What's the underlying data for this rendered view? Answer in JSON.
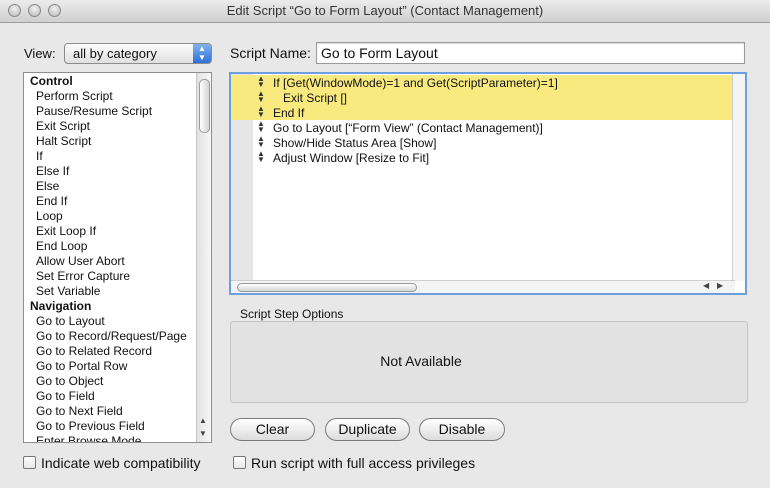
{
  "window": {
    "title": "Edit Script “Go to Form Layout” (Contact Management)"
  },
  "view": {
    "label": "View:",
    "selected": "all by category"
  },
  "script_name": {
    "label": "Script Name:",
    "value": "Go to Form Layout"
  },
  "step_list": {
    "items": [
      {
        "kind": "category",
        "text": "Control"
      },
      {
        "kind": "step",
        "text": "Perform Script"
      },
      {
        "kind": "step",
        "text": "Pause/Resume Script"
      },
      {
        "kind": "step",
        "text": "Exit Script"
      },
      {
        "kind": "step",
        "text": "Halt Script"
      },
      {
        "kind": "step",
        "text": "If"
      },
      {
        "kind": "step",
        "text": "Else If"
      },
      {
        "kind": "step",
        "text": "Else"
      },
      {
        "kind": "step",
        "text": "End If"
      },
      {
        "kind": "step",
        "text": "Loop"
      },
      {
        "kind": "step",
        "text": "Exit Loop If"
      },
      {
        "kind": "step",
        "text": "End Loop"
      },
      {
        "kind": "step",
        "text": "Allow User Abort"
      },
      {
        "kind": "step",
        "text": "Set Error Capture"
      },
      {
        "kind": "step",
        "text": "Set Variable"
      },
      {
        "kind": "category",
        "text": "Navigation"
      },
      {
        "kind": "step",
        "text": "Go to Layout"
      },
      {
        "kind": "step",
        "text": "Go to Record/Request/Page"
      },
      {
        "kind": "step",
        "text": "Go to Related Record"
      },
      {
        "kind": "step",
        "text": "Go to Portal Row"
      },
      {
        "kind": "step",
        "text": "Go to Object"
      },
      {
        "kind": "step",
        "text": "Go to Field"
      },
      {
        "kind": "step",
        "text": "Go to Next Field"
      },
      {
        "kind": "step",
        "text": "Go to Previous Field"
      },
      {
        "kind": "step",
        "text": "Enter Browse Mode"
      }
    ]
  },
  "script_steps": [
    {
      "text": "If [Get(WindowMode)=1 and Get(ScriptParameter)=1]",
      "indent": 0,
      "highlighted": true
    },
    {
      "text": "Exit Script []",
      "indent": 1,
      "highlighted": true
    },
    {
      "text": "End If",
      "indent": 0,
      "highlighted": true
    },
    {
      "text": "Go to Layout [“Form View” (Contact Management)]",
      "indent": 0,
      "highlighted": false
    },
    {
      "text": "Show/Hide Status Area [Show]",
      "indent": 0,
      "highlighted": false
    },
    {
      "text": "Adjust Window [Resize to Fit]",
      "indent": 0,
      "highlighted": false
    }
  ],
  "step_options": {
    "label": "Script Step Options",
    "message": "Not Available"
  },
  "buttons": {
    "clear": "Clear",
    "duplicate": "Duplicate",
    "disable": "Disable"
  },
  "checkboxes": {
    "web_compat": {
      "label": "Indicate web compatibility",
      "checked": false
    },
    "full_access": {
      "label": "Run script with full access privileges",
      "checked": false
    }
  },
  "icons": {
    "grip": "drag-handle-icon",
    "popup_arrows": "updown-arrows-icon",
    "scroll_up": "arrow-up-icon",
    "scroll_down": "arrow-down-icon",
    "scroll_left": "arrow-left-icon",
    "scroll_right": "arrow-right-icon"
  },
  "colors": {
    "highlight": "#f8ea7f",
    "focus_ring": "#6d9fe0",
    "popup_accent": "#2f6fd6"
  }
}
